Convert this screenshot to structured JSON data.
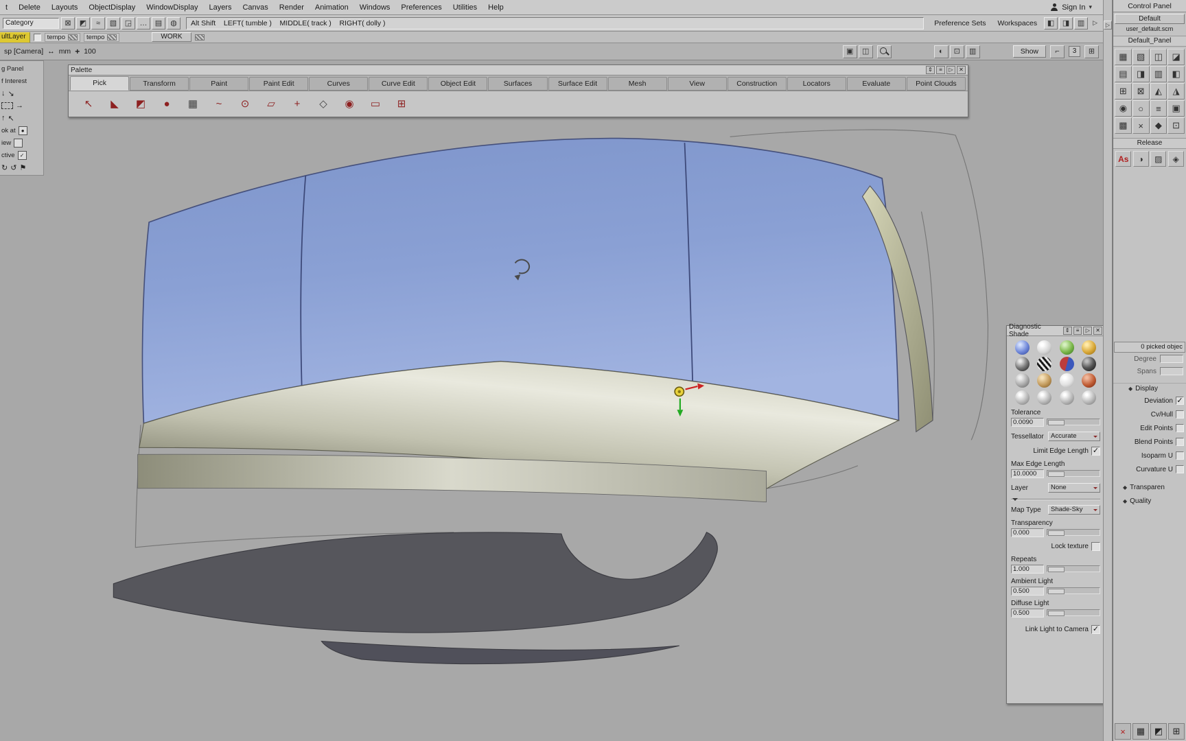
{
  "app": {
    "sign_in": "Sign In"
  },
  "glyphs": {
    "collapse": "⇕",
    "menu": "≡",
    "expand": "▷",
    "close": "✕",
    "caret": "▾",
    "arrow_down": "↓",
    "arrow_down_right": "↘",
    "arrow_right": "→",
    "arrow_up": "↑",
    "arrow_up_left": "↖",
    "rotate_cw": "↻",
    "rotate_ccw": "↺",
    "flag": "⚑",
    "dot": "●",
    "units_arrow": "↔",
    "zoom_cross": "+",
    "panel_arrow": "▷",
    "bracket": "⌐",
    "grid": "⊞",
    "diamond": "◆",
    "check": "✓"
  },
  "menubar": {
    "items": [
      "t",
      "Delete",
      "Layouts",
      "ObjectDisplay",
      "WindowDisplay",
      "Layers",
      "Canvas",
      "Render",
      "Animation",
      "Windows",
      "Preferences",
      "Utilities",
      "Help"
    ]
  },
  "toolbar": {
    "category": "Category",
    "icons": [
      {
        "name": "snap-grid-icon",
        "glyph": "⊠"
      },
      {
        "name": "snap-curve-icon",
        "glyph": "◩"
      },
      {
        "name": "snap-spline-icon",
        "glyph": "≈"
      },
      {
        "name": "snap-surface-icon",
        "glyph": "▧"
      },
      {
        "name": "pivot-icon",
        "glyph": "◲"
      },
      {
        "name": "more-options-icon",
        "glyph": "…"
      },
      {
        "name": "panel-a-icon",
        "glyph": "▤"
      },
      {
        "name": "panel-b-icon",
        "glyph": "◍"
      }
    ],
    "hint": "Alt Shift    LEFT( tumble )    MIDDLE( track )    RIGHT( dolly )",
    "preference_sets": "Preference Sets",
    "workspaces": "Workspaces",
    "right_icons": [
      {
        "name": "workspace-a-icon",
        "glyph": "◧"
      },
      {
        "name": "workspace-b-icon",
        "glyph": "◨"
      },
      {
        "name": "workspace-c-icon",
        "glyph": "▥"
      }
    ]
  },
  "layerbar": {
    "active_layer": "ultLayer",
    "swatch1_label": "tempo",
    "swatch2_label": "tempo",
    "work_button": "WORK"
  },
  "viewbar": {
    "camera": "sp [Camera]",
    "units": "mm",
    "zoom": "100",
    "mid_icons": [
      {
        "name": "camera-view-icon",
        "glyph": "▣"
      },
      {
        "name": "frame-view-icon",
        "glyph": "◫"
      }
    ],
    "right_icons": [
      {
        "name": "view-mode-icon",
        "glyph": "◐"
      },
      {
        "name": "grid-view-icon",
        "glyph": "⊡"
      },
      {
        "name": "panel-view-icon",
        "glyph": "▥"
      }
    ],
    "show_button": "Show",
    "panel_count": "3"
  },
  "left_panel": {
    "row1": "g Panel",
    "row2": "f Interest",
    "look_at": "ok at",
    "view": "iew",
    "active": "ctive"
  },
  "palette": {
    "title": "Palette",
    "tabs": [
      {
        "label": "Pick",
        "active": true
      },
      {
        "label": "Transform",
        "active": false
      },
      {
        "label": "Paint",
        "active": false
      },
      {
        "label": "Paint Edit",
        "active": false
      },
      {
        "label": "Curves",
        "active": false
      },
      {
        "label": "Curve Edit",
        "active": false
      },
      {
        "label": "Object Edit",
        "active": false
      },
      {
        "label": "Surfaces",
        "active": false
      },
      {
        "label": "Surface Edit",
        "active": false
      },
      {
        "label": "Mesh",
        "active": false
      },
      {
        "label": "View",
        "active": false
      },
      {
        "label": "Construction",
        "active": false
      },
      {
        "label": "Locators",
        "active": false
      },
      {
        "label": "Evaluate",
        "active": false
      },
      {
        "label": "Point Clouds",
        "active": false
      }
    ],
    "tools": [
      {
        "name": "pick-nothing-icon",
        "glyph": "↖"
      },
      {
        "name": "pick-object-icon",
        "glyph": "◣"
      },
      {
        "name": "pick-component-icon",
        "glyph": "◩"
      },
      {
        "name": "pick-point-icon",
        "glyph": "●"
      },
      {
        "name": "pick-template-icon",
        "glyph": "▦"
      },
      {
        "name": "pick-curve-icon",
        "glyph": "~"
      },
      {
        "name": "pick-cv-icon",
        "glyph": "⊙"
      },
      {
        "name": "pick-hull-icon",
        "glyph": "▱"
      },
      {
        "name": "pick-edit-point-icon",
        "glyph": "+"
      },
      {
        "name": "pick-locator-icon",
        "glyph": "◇"
      },
      {
        "name": "pick-shader-icon",
        "glyph": "◉"
      },
      {
        "name": "pick-canvas-icon",
        "glyph": "▭"
      },
      {
        "name": "pick-visible-icon",
        "glyph": "⊞"
      }
    ]
  },
  "diagnostic": {
    "title": "Diagnostic Shade",
    "shade_modes": [
      "blue",
      "white",
      "green",
      "gold",
      "dark",
      "zebra",
      "red-blue",
      "black",
      "gray",
      "tan",
      "light",
      "red"
    ],
    "chrome_modes": [
      "silver-1",
      "silver-2",
      "silver-3",
      "silver-4"
    ],
    "tolerance": {
      "label": "Tolerance",
      "value": "0.0090"
    },
    "tessellator": {
      "label": "Tessellator",
      "value": "Accurate"
    },
    "limit_edge": {
      "label": "Limit Edge Length",
      "checked": true
    },
    "max_edge": {
      "label": "Max Edge Length",
      "value": "10.0000"
    },
    "layer": {
      "label": "Layer",
      "value": "None"
    },
    "map_type": {
      "label": "Map Type",
      "value": "Shade-Sky"
    },
    "transparency": {
      "label": "Transparency",
      "value": "0.000"
    },
    "lock_texture": {
      "label": "Lock texture",
      "checked": false
    },
    "repeats": {
      "label": "Repeats",
      "value": "1.000"
    },
    "ambient": {
      "label": "Ambient Light",
      "value": "0.500"
    },
    "diffuse": {
      "label": "Diffuse Light",
      "value": "0.500"
    },
    "link_light": {
      "label": "Link Light to Camera",
      "checked": true
    }
  },
  "control_panel": {
    "header": "Control Panel",
    "preset": "Default",
    "preset_file": "user_default.scm",
    "panel_name": "Default_Panel",
    "grid_icons": [
      {
        "name": "grid-tool-icon",
        "glyph": "▦"
      },
      {
        "name": "surface-tool-icon",
        "glyph": "▧"
      },
      {
        "name": "patch-tool-icon",
        "glyph": "◫"
      },
      {
        "name": "corner-tool-icon",
        "glyph": "◪"
      },
      {
        "name": "shade-tool-icon",
        "glyph": "▤"
      },
      {
        "name": "render-tool-icon",
        "glyph": "◨"
      },
      {
        "name": "layer-tool-icon",
        "glyph": "▥"
      },
      {
        "name": "half-tool-icon",
        "glyph": "◧"
      },
      {
        "name": "plus-tool-icon",
        "glyph": "⊞"
      },
      {
        "name": "cross-tool-icon",
        "glyph": "⊠"
      },
      {
        "name": "prism-tool-icon",
        "glyph": "◭"
      },
      {
        "name": "wedge-tool-icon",
        "glyph": "◮"
      },
      {
        "name": "no-entry-icon",
        "glyph": "◉"
      },
      {
        "name": "circle-tool-icon",
        "glyph": "○"
      },
      {
        "name": "list-tool-icon",
        "glyph": "≡"
      },
      {
        "name": "box-tool-icon",
        "glyph": "▣"
      },
      {
        "name": "lattice-tool-icon",
        "glyph": "▩"
      },
      {
        "name": "delete-tool-icon",
        "glyph": "×"
      },
      {
        "name": "star-tool-icon",
        "glyph": "◆"
      },
      {
        "name": "target-tool-icon",
        "glyph": "⊡"
      }
    ],
    "release_label": "Release",
    "release_icons": [
      {
        "name": "assign-shader-icon",
        "glyph": "As"
      },
      {
        "name": "shader-ball-icon",
        "glyph": "◑"
      },
      {
        "name": "texture-map-icon",
        "glyph": "▨"
      },
      {
        "name": "stage-icon",
        "glyph": "◈"
      }
    ],
    "picked_status": "0 picked objec",
    "degree": {
      "label": "Degree",
      "value": ""
    },
    "spans": {
      "label": "Spans",
      "value": ""
    },
    "display_header": "Display",
    "toggles": [
      {
        "label": "Deviation",
        "checked": true
      },
      {
        "label": "Cv/Hull",
        "checked": false
      },
      {
        "label": "Edit Points",
        "checked": false
      },
      {
        "label": "Blend Points",
        "checked": false
      },
      {
        "label": "Isoparm U",
        "checked": false
      },
      {
        "label": "Curvature U",
        "checked": false
      }
    ],
    "sections": [
      {
        "label": "Transparen"
      },
      {
        "label": "Quality"
      }
    ],
    "bottom_icons": [
      {
        "name": "close-mini-icon",
        "glyph": "×"
      },
      {
        "name": "grid-mini-icon",
        "glyph": "▦"
      },
      {
        "name": "snap-mini-icon",
        "glyph": "◩"
      },
      {
        "name": "info-mini-icon",
        "glyph": "⊞"
      }
    ]
  },
  "viewport": {
    "background_color": "#a8a8a8",
    "roof_color": "#8aa0d4",
    "side_panel_color": "#c2c2b0",
    "locator_color": "#e8d23c",
    "axis_x_color": "#cc2222",
    "axis_y_color": "#22aa22"
  }
}
